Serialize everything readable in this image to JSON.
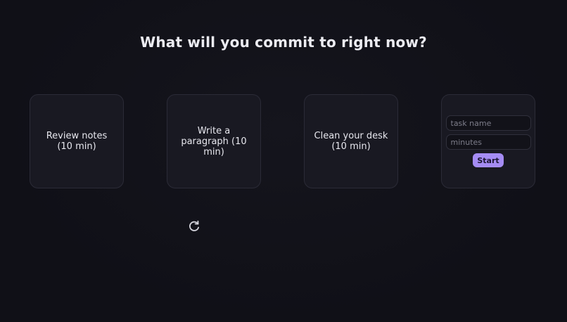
{
  "prompt": {
    "title": "What will you commit to right now?"
  },
  "suggestions": [
    {
      "label": "Review notes (10 min)"
    },
    {
      "label": "Write a paragraph (10 min)"
    },
    {
      "label": "Clean your desk (10 min)"
    }
  ],
  "custom_task": {
    "task_placeholder": "task name",
    "task_value": "",
    "minutes_placeholder": "minutes",
    "minutes_value": "",
    "start_label": "Start"
  },
  "icons": {
    "refresh": "refresh-icon"
  },
  "colors": {
    "background": "#101017",
    "card": "#191922",
    "card_border": "#2b2b37",
    "accent": "#a58cf4",
    "text": "#e6e6ee"
  }
}
